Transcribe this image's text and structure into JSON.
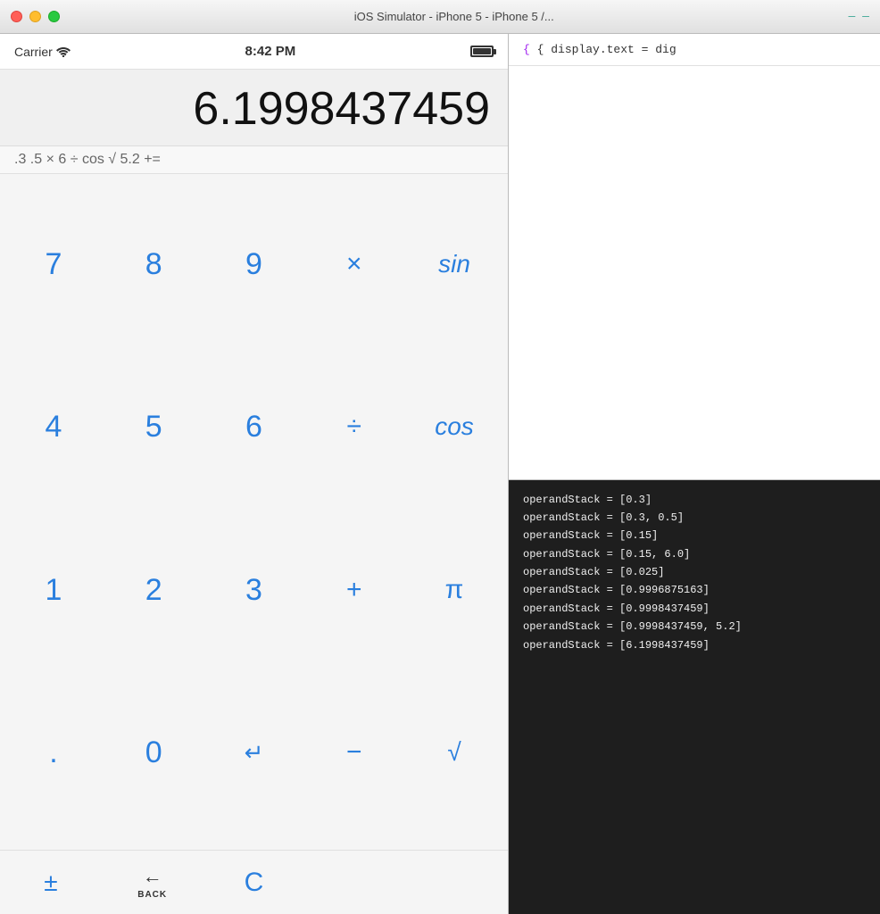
{
  "window": {
    "title": "iOS Simulator - iPhone 5 - iPhone 5 /...",
    "traffic_lights": {
      "close": "close",
      "minimize": "minimize",
      "maximize": "maximize"
    }
  },
  "status_bar": {
    "carrier": "Carrier",
    "time": "8:42 PM",
    "battery": "full"
  },
  "calculator": {
    "display_value": "6.1998437459",
    "expression": ".3 .5 × 6 ÷ cos √ 5.2 +=",
    "rows": [
      {
        "buttons": [
          {
            "label": "7",
            "type": "number"
          },
          {
            "label": "8",
            "type": "number"
          },
          {
            "label": "9",
            "type": "number"
          },
          {
            "label": "×",
            "type": "operator"
          },
          {
            "label": "sin",
            "type": "func"
          }
        ]
      },
      {
        "buttons": [
          {
            "label": "4",
            "type": "number"
          },
          {
            "label": "5",
            "type": "number"
          },
          {
            "label": "6",
            "type": "number"
          },
          {
            "label": "÷",
            "type": "operator"
          },
          {
            "label": "cos",
            "type": "func"
          }
        ]
      },
      {
        "buttons": [
          {
            "label": "1",
            "type": "number"
          },
          {
            "label": "2",
            "type": "number"
          },
          {
            "label": "3",
            "type": "number"
          },
          {
            "label": "+",
            "type": "operator"
          },
          {
            "label": "π",
            "type": "constant"
          }
        ]
      },
      {
        "buttons": [
          {
            "label": ".",
            "type": "number"
          },
          {
            "label": "0",
            "type": "number"
          },
          {
            "label": "↵",
            "type": "enter"
          },
          {
            "label": "−",
            "type": "operator"
          },
          {
            "label": "√",
            "type": "func"
          }
        ]
      }
    ],
    "utility_row": {
      "plus_minus": "±",
      "back_icon": "←",
      "back_label": "BACK",
      "clear": "C"
    }
  },
  "debug": {
    "code_line": "{ display.text = dig",
    "output_lines": [
      "operandStack = [0.3]",
      "operandStack = [0.3, 0.5]",
      "operandStack = [0.15]",
      "operandStack = [0.15, 6.0]",
      "operandStack = [0.025]",
      "operandStack = [0.9996875163]",
      "operandStack = [0.9998437459]",
      "operandStack = [0.9998437459, 5.2]",
      "operandStack = [6.1998437459]"
    ]
  }
}
